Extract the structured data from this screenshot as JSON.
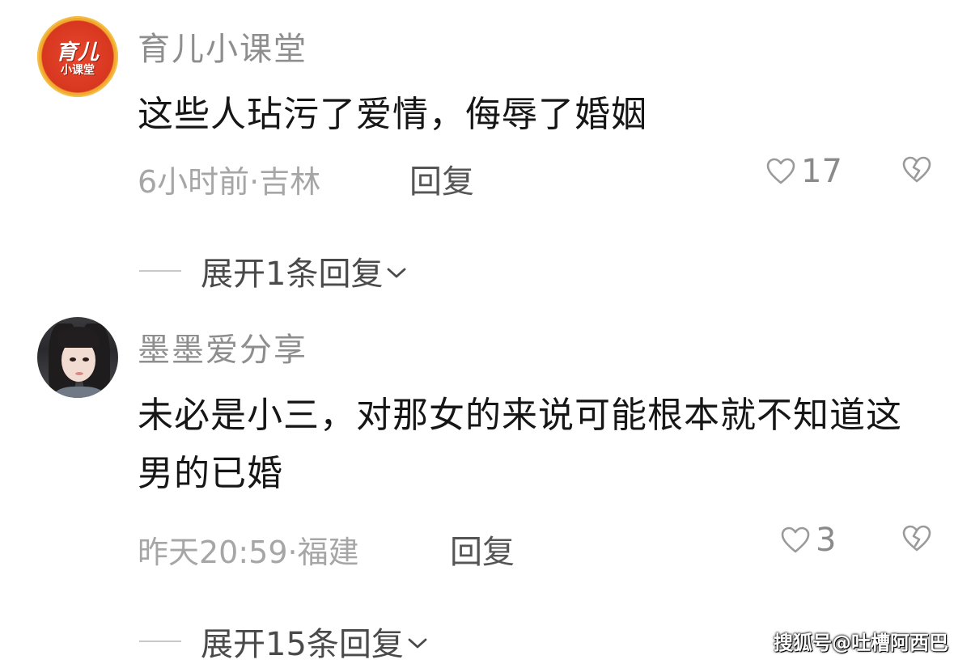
{
  "comments": [
    {
      "username": "育儿小课堂",
      "avatar": {
        "type": "logo",
        "line1": "育儿",
        "line2": "小课堂"
      },
      "text": "这些人玷污了爱情，侮辱了婚姻",
      "meta": "6小时前·吉林",
      "reply_label": "回复",
      "likes": "17",
      "expand_label": "展开1条回复"
    },
    {
      "username": "墨墨爱分享",
      "avatar": {
        "type": "photo"
      },
      "text": "未必是小三，对那女的来说可能根本就不知道这男的已婚",
      "meta": "昨天20:59·福建",
      "reply_label": "回复",
      "likes": "3",
      "expand_label": "展开15条回复"
    }
  ],
  "icons": {
    "like": "heart-outline-icon",
    "dislike": "broken-heart-icon",
    "expand": "chevron-down-icon"
  },
  "colors": {
    "username": "#8e8e8e",
    "text": "#161616",
    "meta": "#a6a6a6",
    "logo_red": "#d8371f",
    "logo_gold": "#f3a92e"
  },
  "watermark": "搜狐号@吐槽阿西巴"
}
